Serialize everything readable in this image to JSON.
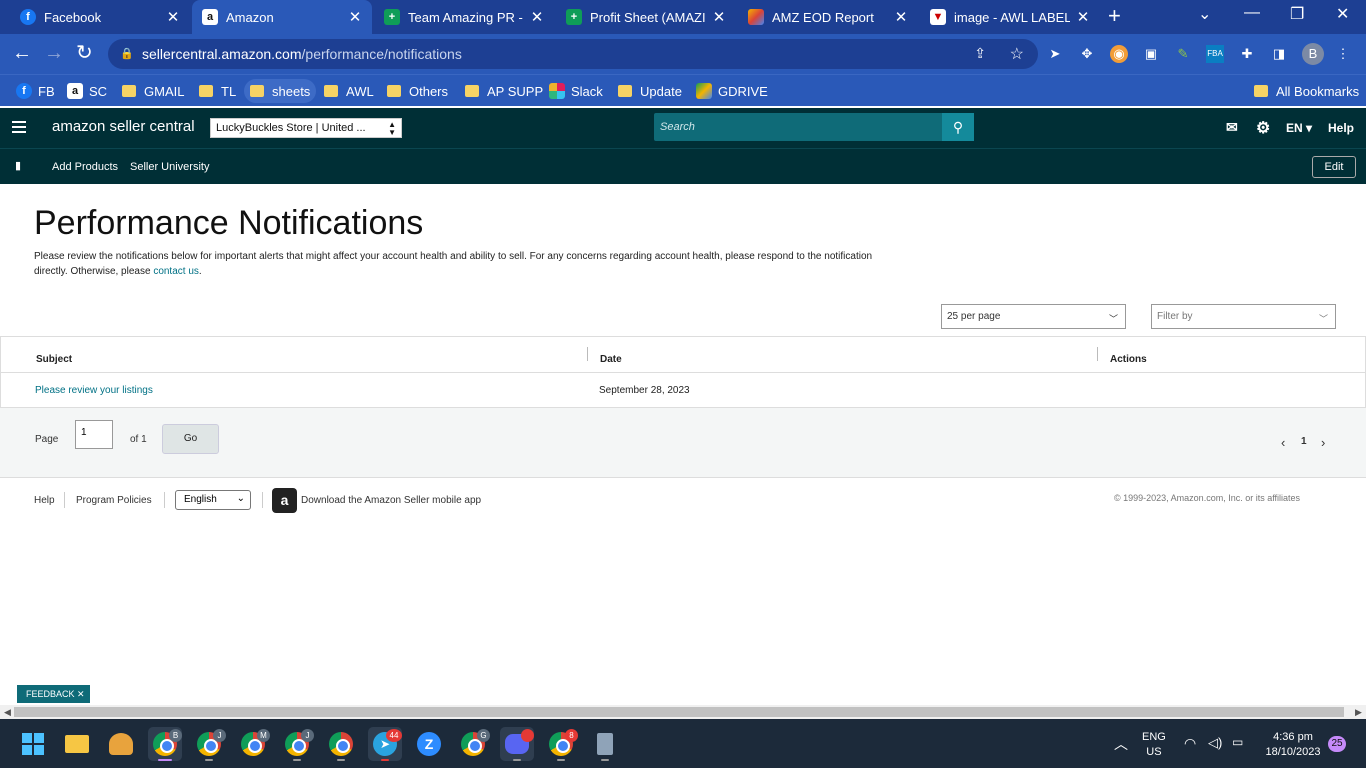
{
  "browser": {
    "tabs": [
      {
        "title": "Facebook",
        "icon": "facebook-icon"
      },
      {
        "title": "Amazon",
        "icon": "amazon-icon"
      },
      {
        "title": "Team Amazing PR - G",
        "icon": "sheets-icon"
      },
      {
        "title": "Profit Sheet (AMAZIN",
        "icon": "sheets-icon"
      },
      {
        "title": "AMZ EOD Report",
        "icon": "report-icon"
      },
      {
        "title": "image - AWL LABEL",
        "icon": "image-icon"
      }
    ],
    "new_tab": "+",
    "url_domain": "sellercentral.amazon.com",
    "url_path": "/performance/notifications",
    "profile_initial": "B",
    "bookmarks": [
      {
        "label": "FB"
      },
      {
        "label": "SC"
      },
      {
        "label": "GMAIL"
      },
      {
        "label": "TL"
      },
      {
        "label": "sheets"
      },
      {
        "label": "AWL"
      },
      {
        "label": "Others"
      },
      {
        "label": "AP SUPP"
      },
      {
        "label": "Slack"
      },
      {
        "label": "Update"
      },
      {
        "label": "GDRIVE"
      }
    ],
    "all_bookmarks": "All Bookmarks"
  },
  "seller_nav": {
    "logo_text": "amazon seller central",
    "store": "LuckyBuckles Store | United ...",
    "search_placeholder": "Search",
    "lang": "EN ▾",
    "help": "Help",
    "sub_links": [
      "Add Products",
      "Seller University"
    ],
    "edit": "Edit"
  },
  "page": {
    "title": "Performance Notifications",
    "description": "Please review the notifications below for important alerts that might affect your account health and ability to sell. For any concerns regarding account health, please respond to the notification directly. Otherwise, please ",
    "contact_link": "contact us",
    "description_end": ".",
    "per_page": "25 per page",
    "filter_placeholder": "Filter by",
    "columns": [
      "Subject",
      "Date",
      "Actions"
    ],
    "rows": [
      {
        "subject": "Please review your listings",
        "date": "September 28, 2023"
      }
    ],
    "pagination": {
      "page_label": "Page",
      "page_value": "1",
      "of_label": "of 1",
      "go": "Go",
      "current": "1"
    }
  },
  "footer": {
    "help": "Help",
    "program_policies": "Program Policies",
    "language": "English",
    "app_download": "Download the Amazon Seller mobile app",
    "copyright": "© 1999-2023, Amazon.com, Inc. or its affiliates"
  },
  "feedback": "FEEDBACK ✕",
  "taskbar": {
    "lang_top": "ENG",
    "lang_bottom": "US",
    "time": "4:36 pm",
    "date": "18/10/2023",
    "notif_count": "25",
    "telegram_badge": "44"
  }
}
